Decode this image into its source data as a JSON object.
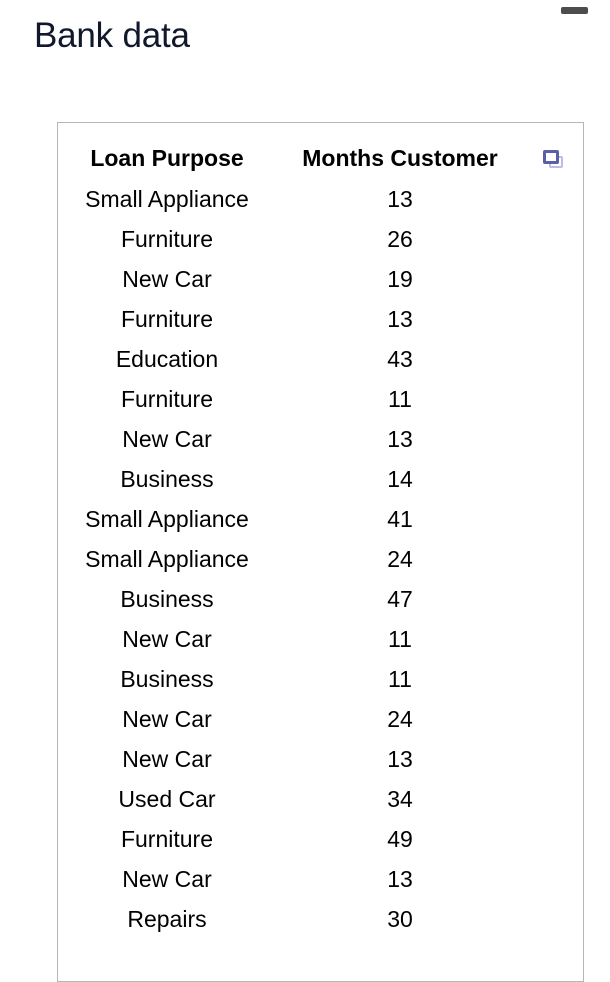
{
  "window": {
    "handle_icon": "window-drag-handle"
  },
  "header": {
    "title": "Bank data",
    "title_color": "#12182b"
  },
  "table": {
    "border_color": "#b6b6b6",
    "copy_icon": "copy-icon",
    "columns": [
      {
        "key": "loan_purpose",
        "label": "Loan Purpose"
      },
      {
        "key": "months_customer",
        "label": "Months Customer"
      }
    ],
    "rows": [
      {
        "loan_purpose": "Small Appliance",
        "months_customer": "13"
      },
      {
        "loan_purpose": "Furniture",
        "months_customer": "26"
      },
      {
        "loan_purpose": "New Car",
        "months_customer": "19"
      },
      {
        "loan_purpose": "Furniture",
        "months_customer": "13"
      },
      {
        "loan_purpose": "Education",
        "months_customer": "43"
      },
      {
        "loan_purpose": "Furniture",
        "months_customer": "11"
      },
      {
        "loan_purpose": "New Car",
        "months_customer": "13"
      },
      {
        "loan_purpose": "Business",
        "months_customer": "14"
      },
      {
        "loan_purpose": "Small Appliance",
        "months_customer": "41"
      },
      {
        "loan_purpose": "Small Appliance",
        "months_customer": "24"
      },
      {
        "loan_purpose": "Business",
        "months_customer": "47"
      },
      {
        "loan_purpose": "New Car",
        "months_customer": "11"
      },
      {
        "loan_purpose": "Business",
        "months_customer": "11"
      },
      {
        "loan_purpose": "New Car",
        "months_customer": "24"
      },
      {
        "loan_purpose": "New Car",
        "months_customer": "13"
      },
      {
        "loan_purpose": "Used Car",
        "months_customer": "34"
      },
      {
        "loan_purpose": "Furniture",
        "months_customer": "49"
      },
      {
        "loan_purpose": "New Car",
        "months_customer": "13"
      },
      {
        "loan_purpose": "Repairs",
        "months_customer": "30"
      }
    ]
  }
}
